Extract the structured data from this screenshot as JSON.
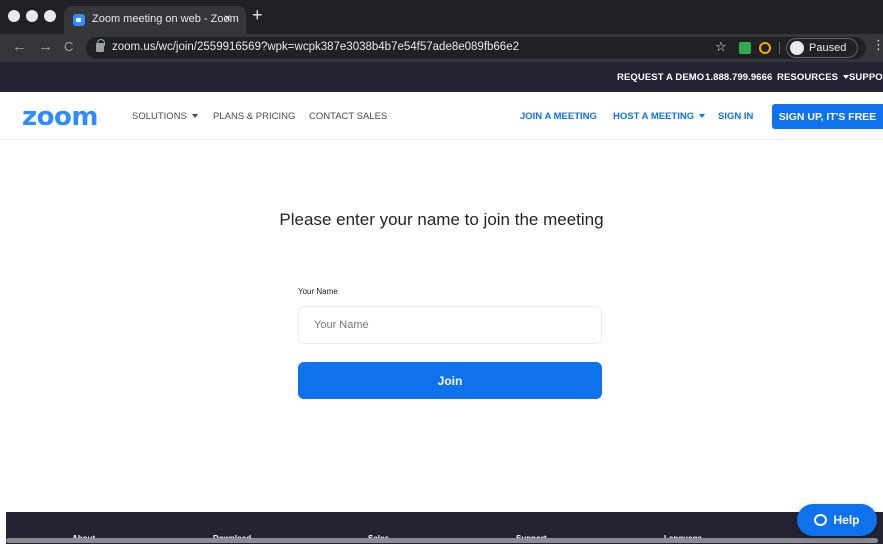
{
  "browser": {
    "tab_title": "Zoom meeting on web - Zoom",
    "tab_close": "×",
    "new_tab": "+",
    "url": "zoom.us/wc/join/2559916569?wpk=wcpk387e3038b4b7e54f57ade8e089fb66e2",
    "profile_label": "Paused",
    "back": "←",
    "forward": "→",
    "reload": "C",
    "star": "☆",
    "menu": "⋮"
  },
  "utility_bar": {
    "request_demo": "REQUEST A DEMO",
    "phone": "1.888.799.9666",
    "resources": "RESOURCES",
    "support": "SUPPORT"
  },
  "nav": {
    "logo": "zoom",
    "solutions": "SOLUTIONS",
    "plans": "PLANS & PRICING",
    "contact": "CONTACT SALES",
    "join": "JOIN A MEETING",
    "host": "HOST A MEETING",
    "signin": "SIGN IN",
    "signup": "SIGN UP, IT'S FREE"
  },
  "form": {
    "heading": "Please enter your name to join the meeting",
    "label": "Your Name",
    "placeholder": "Your Name",
    "value": "",
    "join_button": "Join"
  },
  "footer": {
    "items": [
      "About",
      "Download",
      "Sales",
      "Support",
      "Language"
    ]
  },
  "help": {
    "label": "Help"
  },
  "colors": {
    "brand": "#2d8cff",
    "primary_button": "#0e72ed",
    "dark_bar": "#232333"
  }
}
